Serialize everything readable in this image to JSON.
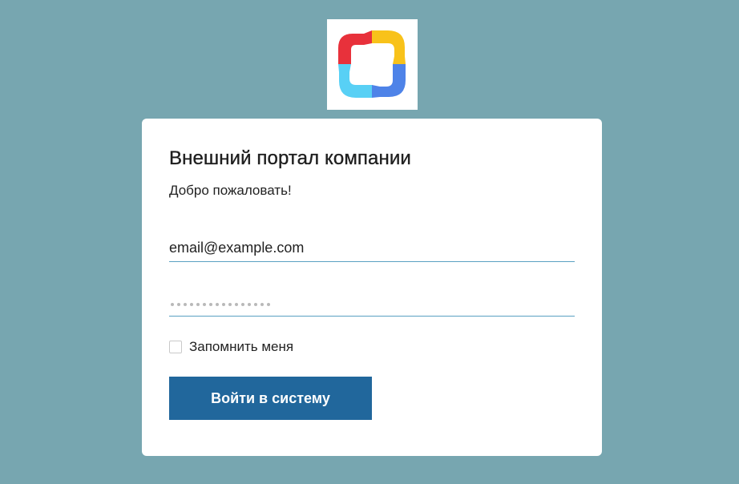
{
  "logo": {
    "icon": "company-logo-icon",
    "colors": {
      "red": "#e8313b",
      "yellow": "#f8c21a",
      "blue": "#4e83e8",
      "cyan": "#58d0f5"
    }
  },
  "login": {
    "title": "Внешний портал компании",
    "subtitle": "Добро пожаловать!",
    "email_value": "email@example.com",
    "password_mask_length": 16,
    "remember_label": "Запомнить меня",
    "remember_checked": false,
    "submit_label": "Войти в систему"
  },
  "colors": {
    "background": "#77a6b0",
    "card": "#ffffff",
    "button": "#21679c",
    "field_underline": "#5aa1c2"
  }
}
